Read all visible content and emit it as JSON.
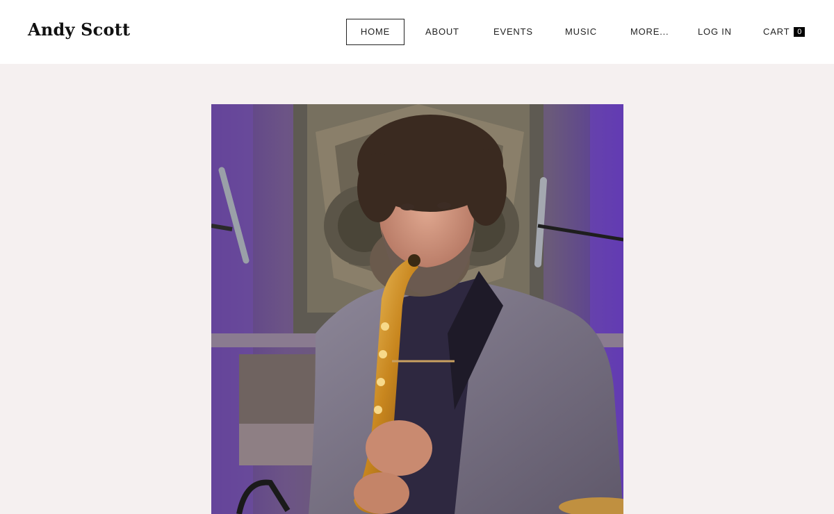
{
  "site": {
    "title": "Andy Scott"
  },
  "nav": {
    "items": [
      {
        "label": "HOME",
        "active": true
      },
      {
        "label": "ABOUT",
        "active": false
      },
      {
        "label": "EVENTS",
        "active": false
      },
      {
        "label": "MUSIC",
        "active": false
      },
      {
        "label": "MORE...",
        "active": false
      },
      {
        "label": "LOG IN",
        "active": false
      }
    ],
    "cart": {
      "label": "CART",
      "count": "0"
    }
  },
  "hero": {
    "image_icon": "saxophonist-photo"
  },
  "colors": {
    "page_background": "#f5f0f0",
    "header_background": "#ffffff",
    "text": "#222222",
    "cart_badge": "#000000"
  }
}
